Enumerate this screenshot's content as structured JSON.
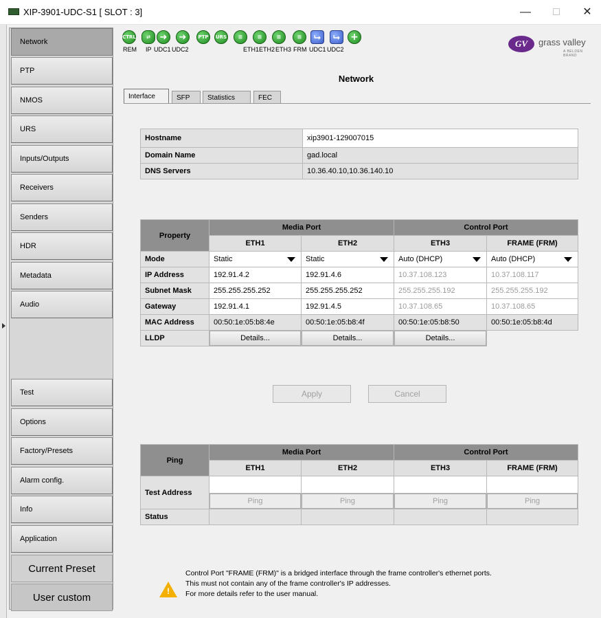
{
  "window": {
    "title": "XIP-3901-UDC-S1 [ SLOT : 3]",
    "minimize": "—",
    "maximize": "□",
    "close": "✕"
  },
  "sidebar": {
    "items": [
      "Network",
      "PTP",
      "NMOS",
      "URS",
      "Inputs/Outputs",
      "Receivers",
      "Senders",
      "HDR",
      "Metadata",
      "Audio",
      "Test",
      "Options",
      "Factory/Presets",
      "Alarm config.",
      "Info",
      "Application"
    ],
    "current_preset": "Current Preset",
    "user_custom": "User custom"
  },
  "status_icons": [
    {
      "icon": "ctrl",
      "label": "REM"
    },
    {
      "icon": "ip",
      "label": "IP"
    },
    {
      "icon": "udc1",
      "label": "UDC1"
    },
    {
      "icon": "udc2",
      "label": "UDC2"
    },
    {
      "icon": "ptp",
      "label": ""
    },
    {
      "icon": "urs",
      "label": ""
    },
    {
      "icon": "eth1",
      "label": "ETH1"
    },
    {
      "icon": "eth2",
      "label": "ETH2"
    },
    {
      "icon": "eth3",
      "label": "ETH3"
    },
    {
      "icon": "frm",
      "label": "FRM"
    },
    {
      "icon": "udc1b",
      "label": "UDC1"
    },
    {
      "icon": "udc2b",
      "label": "UDC2"
    },
    {
      "icon": "plus",
      "label": ""
    }
  ],
  "icon_text": {
    "ctrl": "CTRL",
    "ptp": "PTP",
    "urs": "URS"
  },
  "logo": {
    "mark": "GV",
    "text": "grass valley",
    "sub": "A BELDEN BRAND"
  },
  "page_title": "Network",
  "tabs": [
    "Interface",
    "SFP",
    "Statistics",
    "FEC"
  ],
  "host": {
    "rows": [
      {
        "label": "Hostname",
        "value": "xip3901-129007015"
      },
      {
        "label": "Domain Name",
        "value": "gad.local"
      },
      {
        "label": "DNS Servers",
        "value": "10.36.40.10,10.36.140.10"
      }
    ]
  },
  "ports": {
    "property_label": "Property",
    "media_port": "Media Port",
    "control_port": "Control Port",
    "columns": [
      "ETH1",
      "ETH2",
      "ETH3",
      "FRAME (FRM)"
    ],
    "mode_label": "Mode",
    "modes": [
      "Static",
      "Static",
      "Auto (DHCP)",
      "Auto (DHCP)"
    ],
    "ip_label": "IP Address",
    "ips": [
      "192.91.4.2",
      "192.91.4.6",
      "10.37.108.123",
      "10.37.108.117"
    ],
    "mask_label": "Subnet Mask",
    "masks": [
      "255.255.255.252",
      "255.255.255.252",
      "255.255.255.192",
      "255.255.255.192"
    ],
    "gw_label": "Gateway",
    "gateways": [
      "192.91.4.1",
      "192.91.4.5",
      "10.37.108.65",
      "10.37.108.65"
    ],
    "mac_label": "MAC Address",
    "macs": [
      "00:50:1e:05:b8:4e",
      "00:50:1e:05:b8:4f",
      "00:50:1e:05:b8:50",
      "00:50:1e:05:b8:4d"
    ],
    "lldp_label": "LLDP",
    "details": "Details..."
  },
  "actions": {
    "apply": "Apply",
    "cancel": "Cancel"
  },
  "ping": {
    "label": "Ping",
    "media_port": "Media Port",
    "control_port": "Control Port",
    "columns": [
      "ETH1",
      "ETH2",
      "ETH3",
      "FRAME (FRM)"
    ],
    "test_address": "Test Address",
    "ping_button": "Ping",
    "status": "Status"
  },
  "note": {
    "line1": "Control Port \"FRAME (FRM)\" is a bridged interface through the frame controller's ethernet ports.",
    "line2": "This must not contain any of the frame controller's IP addresses.",
    "line3": "For more details refer to the user manual."
  }
}
